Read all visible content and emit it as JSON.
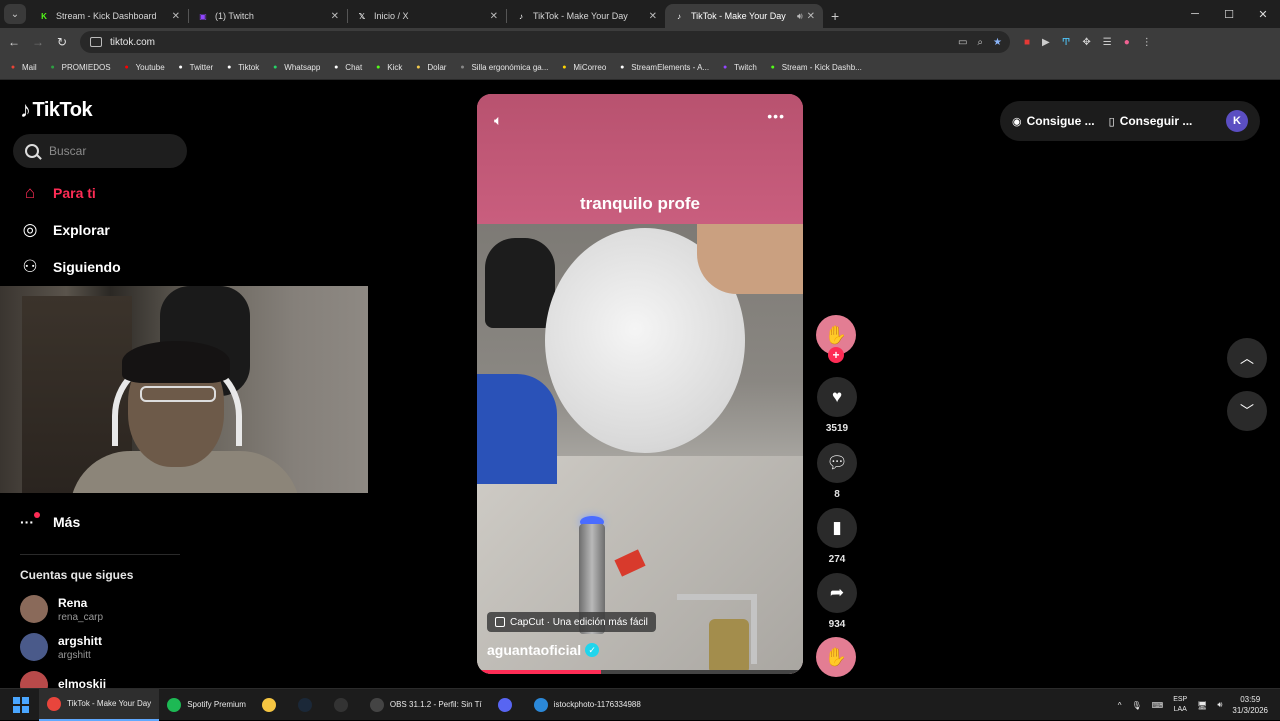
{
  "browser": {
    "tabs": [
      {
        "label": "Stream - Kick Dashboard",
        "icon": "kick-icon",
        "color": "#53fc18",
        "active": false
      },
      {
        "label": "(1) Twitch",
        "icon": "twitch-icon",
        "color": "#9146ff",
        "active": false
      },
      {
        "label": "Inicio / X",
        "icon": "x-icon",
        "color": "#ffffff",
        "active": false
      },
      {
        "label": "TikTok - Make Your Day",
        "icon": "tiktok-icon",
        "color": "#ffffff",
        "active": false
      },
      {
        "label": "TikTok - Make Your Day",
        "icon": "tiktok-icon",
        "color": "#ffffff",
        "active": true
      }
    ],
    "url": "tiktok.com",
    "bookmarks": [
      {
        "label": "Mail",
        "icon": "gmail-icon",
        "color": "#ea4335"
      },
      {
        "label": "PROMIEDOS",
        "icon": "promiedos-icon",
        "color": "#2ea043"
      },
      {
        "label": "Youtube",
        "icon": "youtube-icon",
        "color": "#ff0000"
      },
      {
        "label": "Twitter",
        "icon": "x-icon",
        "color": "#ffffff"
      },
      {
        "label": "Tiktok",
        "icon": "tiktok-icon",
        "color": "#ffffff"
      },
      {
        "label": "Whatsapp",
        "icon": "whatsapp-icon",
        "color": "#25d366"
      },
      {
        "label": "Chat",
        "icon": "chatgpt-icon",
        "color": "#ffffff"
      },
      {
        "label": "Kick",
        "icon": "kick-icon",
        "color": "#53fc18"
      },
      {
        "label": "Dolar",
        "icon": "dollar-icon",
        "color": "#f2c94c"
      },
      {
        "label": "Silla ergonómica ga...",
        "icon": "dash-icon",
        "color": "#888888"
      },
      {
        "label": "MiCorreo",
        "icon": "correo-icon",
        "color": "#ffd400"
      },
      {
        "label": "StreamElements - A...",
        "icon": "streamelements-icon",
        "color": "#ffffff"
      },
      {
        "label": "Twitch",
        "icon": "twitch-icon",
        "color": "#9146ff"
      },
      {
        "label": "Stream - Kick Dashb...",
        "icon": "kick-icon",
        "color": "#53fc18"
      }
    ]
  },
  "tiktok": {
    "logo": "TikTok",
    "search_placeholder": "Buscar",
    "nav": {
      "for_you": "Para ti",
      "explore": "Explorar",
      "following": "Siguiendo",
      "more": "Más"
    },
    "following_title": "Cuentas que sigues",
    "accounts": [
      {
        "name": "Rena",
        "handle": "rena_carp",
        "color": "#8a6a5a"
      },
      {
        "name": "argshitt",
        "handle": "argshitt",
        "color": "#4a5a8a"
      },
      {
        "name": "elmoskii_",
        "handle": "",
        "color": "#b84a4a"
      }
    ],
    "video": {
      "caption": "tranquilo profe",
      "capcut_label": "CapCut · Una edición más fácil",
      "author": "aguantaoficial",
      "progress": 0.38
    },
    "actions": {
      "likes": "3519",
      "comments": "8",
      "saves": "274",
      "shares": "934"
    },
    "topright": {
      "coins": "Consigue ...",
      "app": "Conseguir ..."
    },
    "accent": "#fe2c55"
  },
  "taskbar": {
    "items": [
      {
        "label": "TikTok - Make Your Day",
        "icon": "chrome-icon",
        "color": "#e8453c",
        "active": true
      },
      {
        "label": "Spotify Premium",
        "icon": "spotify-icon",
        "color": "#1db954",
        "active": false
      },
      {
        "label": "",
        "icon": "folder-icon",
        "color": "#f5c542",
        "active": false
      },
      {
        "label": "",
        "icon": "steam-icon",
        "color": "#1b2838",
        "active": false
      },
      {
        "label": "",
        "icon": "epic-icon",
        "color": "#333333",
        "active": false
      },
      {
        "label": "OBS 31.1.2 - Perfil: Sin Tí",
        "icon": "obs-icon",
        "color": "#444444",
        "active": false
      },
      {
        "label": "",
        "icon": "discord-icon",
        "color": "#5865f2",
        "active": false
      },
      {
        "label": "istockphoto-1176334988",
        "icon": "photos-icon",
        "color": "#2b88d8",
        "active": false
      }
    ],
    "lang_top": "ESP",
    "lang_bottom": "LAA",
    "time": "03:59",
    "date": "31/3/2026"
  }
}
